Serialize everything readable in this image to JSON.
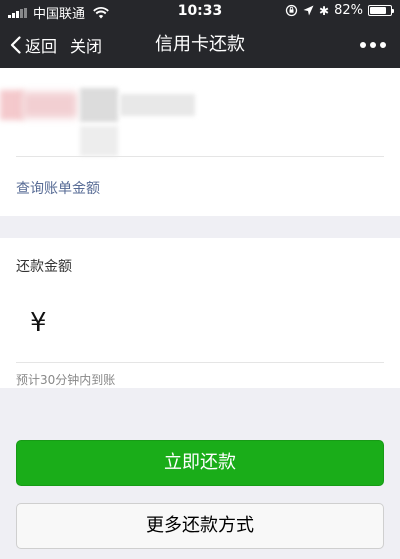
{
  "status_bar": {
    "carrier": "中国联通",
    "time": "10:33",
    "battery_percent": "82%",
    "battery_level": 0.82,
    "icons": [
      "signal-icon",
      "wifi-icon",
      "orientation-lock-icon",
      "location-icon",
      "bluetooth-icon",
      "battery-icon"
    ]
  },
  "nav": {
    "back_label": "返回",
    "close_label": "关闭",
    "title": "信用卡还款",
    "more_icon": "more-icon"
  },
  "card": {
    "query_link": "查询账单金额"
  },
  "form": {
    "amount_label": "还款金额",
    "currency_symbol": "¥",
    "amount_value": "",
    "hint": "预计30分钟内到账"
  },
  "actions": {
    "primary_label": "立即还款",
    "secondary_label": "更多还款方式"
  },
  "colors": {
    "nav_bg": "#26272b",
    "page_bg": "#efeff4",
    "primary_green": "#1aad19",
    "link_blue": "#576b95"
  }
}
